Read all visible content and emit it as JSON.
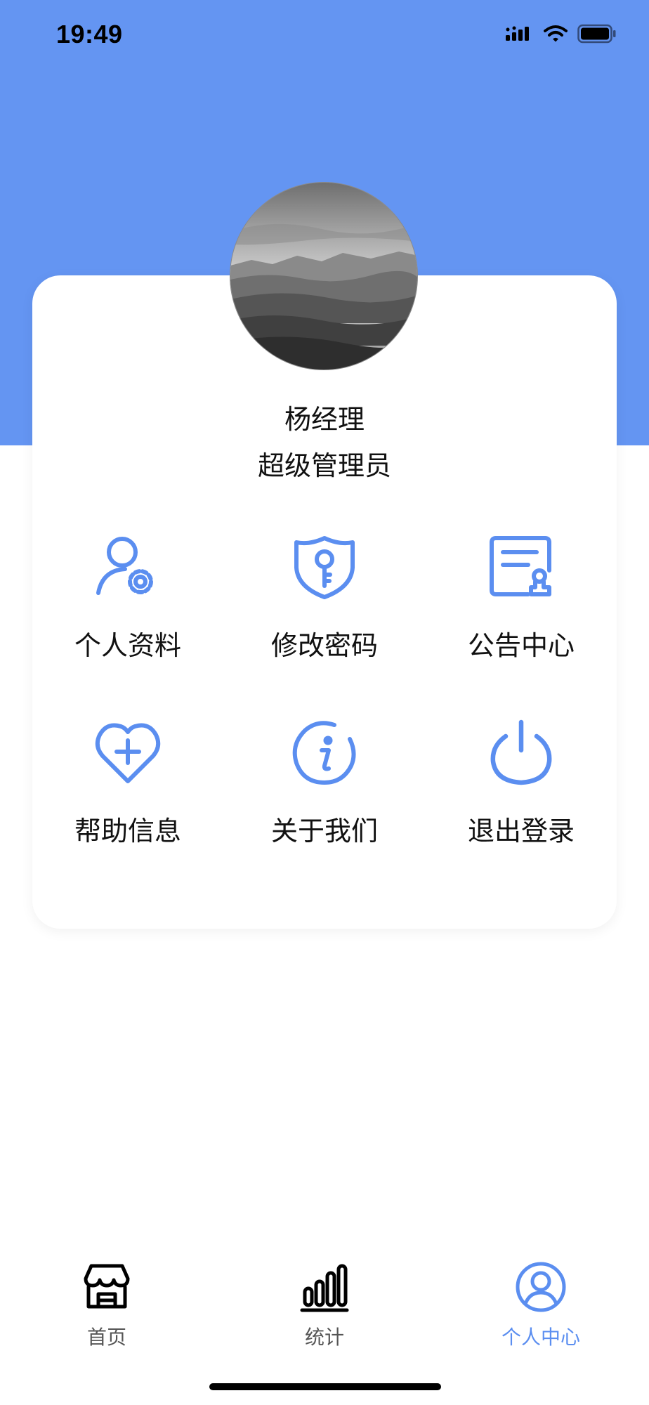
{
  "status_bar": {
    "time": "19:49",
    "icons": [
      "cellular-signal-icon",
      "wifi-icon",
      "battery-icon"
    ]
  },
  "profile": {
    "name": "杨经理",
    "role": "超级管理员",
    "avatar": "landscape-photo"
  },
  "menu": {
    "items": [
      {
        "label": "个人资料",
        "icon": "user-settings-icon"
      },
      {
        "label": "修改密码",
        "icon": "shield-key-icon"
      },
      {
        "label": "公告中心",
        "icon": "certificate-icon"
      },
      {
        "label": "帮助信息",
        "icon": "heart-plus-icon"
      },
      {
        "label": "关于我们",
        "icon": "info-icon"
      },
      {
        "label": "退出登录",
        "icon": "power-icon"
      }
    ]
  },
  "tabbar": {
    "tabs": [
      {
        "label": "首页",
        "icon": "store-icon",
        "active": false
      },
      {
        "label": "统计",
        "icon": "bar-chart-icon",
        "active": false
      },
      {
        "label": "个人中心",
        "icon": "user-circle-icon",
        "active": true
      }
    ]
  },
  "colors": {
    "header_bg": "#6495f2",
    "icon_blue": "#5b8ef0",
    "active_tab": "#5b8ef0",
    "inactive_tab": "#555555",
    "text": "#111111"
  }
}
